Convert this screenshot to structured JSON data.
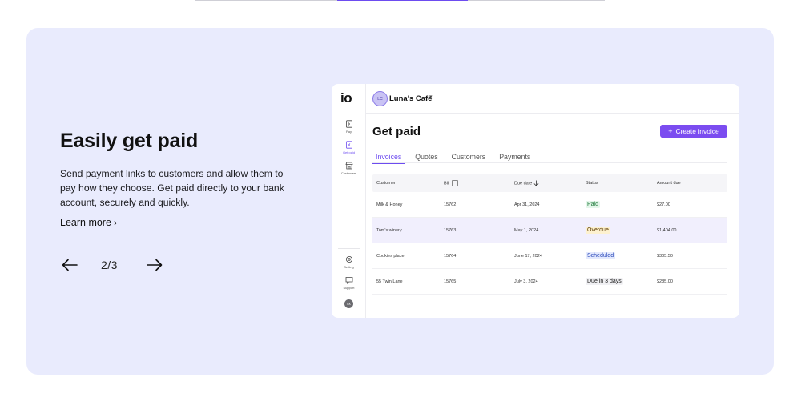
{
  "carousel": {
    "headline": "Easily get paid",
    "description": "Send payment links to customers and allow them to pay how they choose. Get paid directly to your bank account, securely and quickly.",
    "learn_more": "Learn more",
    "learn_more_chevron": "›",
    "counter": "2/3",
    "progress": {
      "current": 2,
      "total": 3
    }
  },
  "app": {
    "logo": "io",
    "sidebar": {
      "items": [
        {
          "label": "Pay",
          "icon": "pay-icon",
          "active": false
        },
        {
          "label": "Get paid",
          "icon": "get-paid-icon",
          "active": true
        },
        {
          "label": "Customers",
          "icon": "store-icon",
          "active": false
        }
      ],
      "bottom": [
        {
          "label": "Setting",
          "icon": "gear-icon"
        },
        {
          "label": "Support",
          "icon": "chat-icon"
        }
      ],
      "avatar": "CK"
    },
    "business": {
      "name": "Luna's Cafe",
      "caret": "▾",
      "avatar": "LC"
    },
    "page_title": "Get paid",
    "create_button": "Create invoice",
    "tabs": [
      "Invoices",
      "Quotes",
      "Customers",
      "Payments"
    ],
    "table": {
      "headers": [
        "Customer",
        "Bill",
        "Due date",
        "Status",
        "Amount due"
      ],
      "rows": [
        {
          "customer": "Milk & Honey",
          "bill": "15762",
          "due": "Apr 31, 2024",
          "status": "Paid",
          "status_kind": "paid",
          "amount": "$27.00"
        },
        {
          "customer": "Tom's winery",
          "bill": "15763",
          "due": "May 1, 2024",
          "status": "Overdue",
          "status_kind": "overdue",
          "amount": "$1,404.00"
        },
        {
          "customer": "Cookies place",
          "bill": "15764",
          "due": "June 17, 2024",
          "status": "Scheduled",
          "status_kind": "scheduled",
          "amount": "$305.50"
        },
        {
          "customer": "55 Twin Lane",
          "bill": "15765",
          "due": "July 3, 2024",
          "status": "Due in 3 days",
          "status_kind": "due",
          "amount": "$285.00"
        }
      ]
    }
  },
  "colors": {
    "accent": "#6d4cf0",
    "card_bg": "#e9ebfd",
    "button": "#7b4cf0"
  }
}
